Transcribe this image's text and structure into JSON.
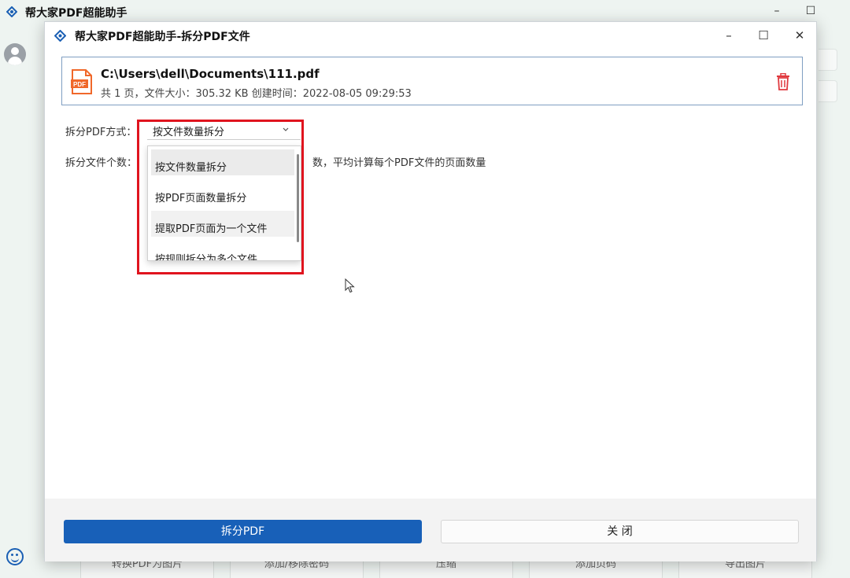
{
  "background_app": {
    "title": "帮大家PDF超能助手",
    "minimize": "–",
    "maximize": "☐",
    "bottom_buttons": [
      "转换PDF为图片",
      "添加/移除密码",
      "压缩",
      "添加页码",
      "导出图片"
    ]
  },
  "dialog": {
    "title": "帮大家PDF超能助手-拆分PDF文件",
    "minimize": "–",
    "maximize": "☐",
    "close": "✕",
    "file": {
      "path": "C:\\Users\\dell\\Documents\\111.pdf",
      "meta": "共 1 页，文件大小：305.32 KB 创建时间：2022-08-05 09:29:53",
      "icon_label": "PDF"
    },
    "split_mode": {
      "label": "拆分PDF方式：",
      "selected": "按文件数量拆分",
      "options": [
        "按文件数量拆分",
        "按PDF页面数量拆分",
        "提取PDF页面为一个文件",
        "按规则拆分为多个文件"
      ]
    },
    "split_count": {
      "label": "拆分文件个数：",
      "hint": "数，平均计算每个PDF文件的页面数量"
    },
    "buttons": {
      "split": "拆分PDF",
      "close": "关 闭"
    }
  },
  "colors": {
    "primary": "#1860b8",
    "highlight": "#e0141e",
    "pdf_orange": "#f0682a",
    "trash_red": "#e0393e"
  }
}
